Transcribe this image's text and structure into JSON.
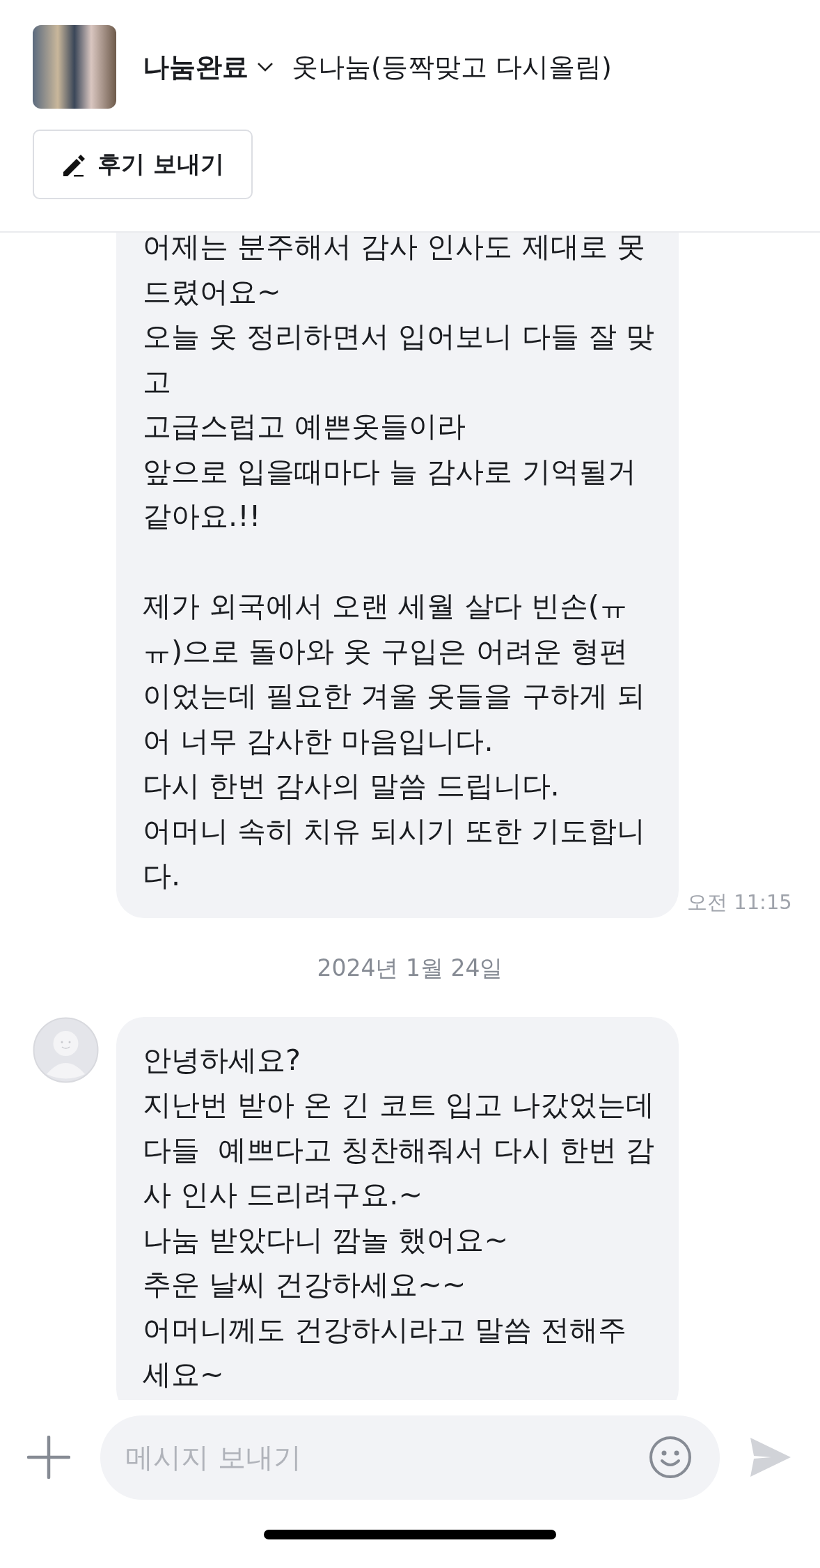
{
  "header": {
    "status": "나눔완료",
    "title": "옷나눔(등짝맞고 다시올림)",
    "review_button": "후기 보내기"
  },
  "messages": [
    {
      "kind": "message",
      "avatar": false,
      "text": "어제는 분주해서 감사 인사도 제대로 못 드렸어요~\n오늘 옷 정리하면서 입어보니 다들 잘 맞고\n고급스럽고 예쁜옷들이라\n앞으로 입을때마다 늘 감사로 기억될거 같아요.!!\n\n제가 외국에서 오랜 세월 살다 빈손(ㅠㅠ)으로 돌아와 옷 구입은 어려운 형편이었는데 필요한 겨울 옷들을 구하게 되어 너무 감사한 마음입니다.\n다시 한번 감사의 말씀 드립니다.\n어머니 속히 치유 되시기 또한 기도합니다.",
      "time": "오전 11:15"
    },
    {
      "kind": "date",
      "text": "2024년 1월 24일"
    },
    {
      "kind": "message",
      "avatar": true,
      "text": "안녕하세요?\n지난번 받아 온 긴 코트 입고 나갔었는데 다들  예쁘다고 칭찬해줘서 다시 한번 감사 인사 드리려구요.~\n나눔 받았다니 깜놀 했어요~\n추운 날씨 건강하세요~~\n어머니께도 건강하시라고 말씀 전해주세요~"
    }
  ],
  "composer": {
    "placeholder": "메시지 보내기"
  }
}
